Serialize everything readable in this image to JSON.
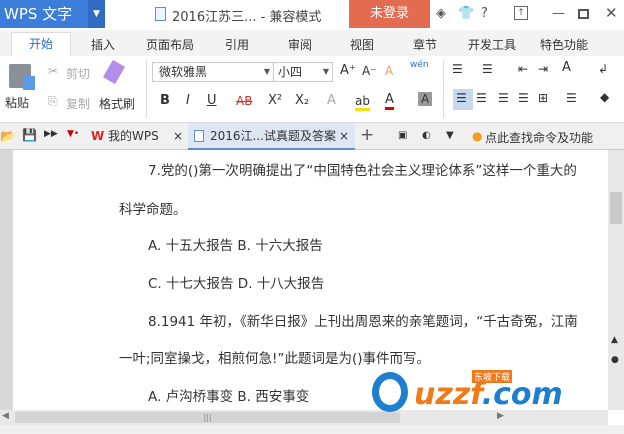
{
  "titlebar": {
    "app_name": "WPS 文字",
    "doc_title": "2016江苏三... - 兼容模式",
    "login": "未登录",
    "help": "?"
  },
  "ribbon_tabs": [
    "开始",
    "插入",
    "页面布局",
    "引用",
    "审阅",
    "视图",
    "章节",
    "开发工具",
    "特色功能"
  ],
  "ribbon": {
    "paste": "粘贴",
    "cut": "剪切",
    "copy": "复制",
    "format_painter": "格式刷",
    "font_name": "微软雅黑",
    "font_size": "小四",
    "pinyin": "wén",
    "bold": "B",
    "italic": "I",
    "underline": "U",
    "strike": "AB",
    "superscript": "X²",
    "subscript": "X₂",
    "grow": "A⁺",
    "shrink": "A⁻"
  },
  "doc_tabs": {
    "my_wps": "我的WPS",
    "doc": "2016江...试真题及答案",
    "add": "+",
    "search": "点此查找命令及功能"
  },
  "document": {
    "lines": [
      "7.党的()第一次明确提出了“中国特色社会主义理论体系”这样一个重大的",
      "科学命题。",
      "A. 十五大报告 B. 十六大报告",
      "C. 十七大报告 D. 十八大报告",
      "8.1941 年初，《新华日报》上刊出周恩来的亲笔题词，“千古奇冤，江南",
      "一叶;同室操戈，相煎何急!”此题词是为()事件而写。",
      "A. 卢沟桥事变 B. 西安事变"
    ]
  },
  "watermark": {
    "text": "uzzf.com",
    "sub": "东坡下载"
  }
}
